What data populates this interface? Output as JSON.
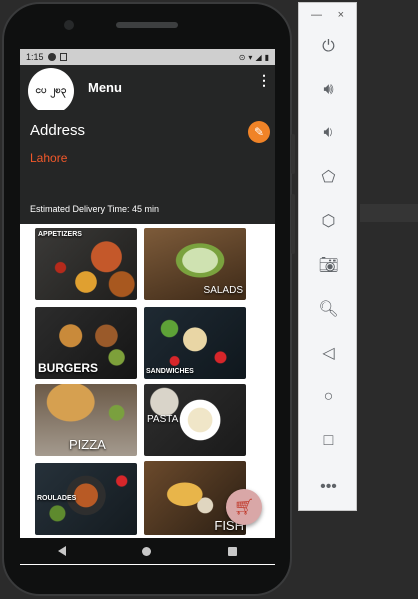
{
  "status": {
    "time": "1:15"
  },
  "appbar": {
    "title": "Menu",
    "logo_text": "ငပ ၂ၿ၃"
  },
  "header": {
    "address_label": "Address",
    "address_value": "Lahore",
    "delivery_text": "Estimated Delivery Time: 45 min"
  },
  "categories": [
    {
      "label": "APPETIZERS"
    },
    {
      "label": "SALADS"
    },
    {
      "label": "BURGERS"
    },
    {
      "label": "SANDWICHES"
    },
    {
      "label": "PIZZA"
    },
    {
      "label": "PASTA"
    },
    {
      "label": "ROULADES"
    },
    {
      "label": "FISH"
    }
  ],
  "emulator": {
    "minimize": "—",
    "close": "×",
    "tools": [
      "power-icon",
      "volume-up-icon",
      "volume-down-icon",
      "rotate-left-icon",
      "rotate-right-icon",
      "camera-icon",
      "zoom-icon",
      "back-icon",
      "home-icon",
      "overview-icon",
      "more-icon"
    ]
  },
  "colors": {
    "accent": "#f2582a",
    "fab": "#f08327",
    "appbar": "#252626"
  }
}
